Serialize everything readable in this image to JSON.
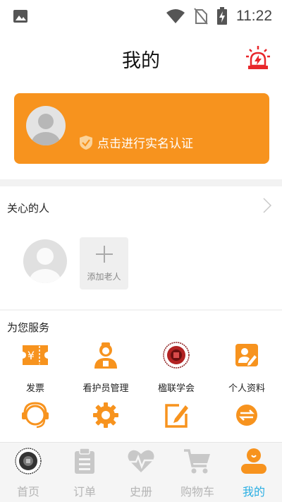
{
  "status_bar": {
    "time": "11:22",
    "icons": [
      "image-icon",
      "wifi-icon",
      "no-sim-icon",
      "battery-charging-icon"
    ]
  },
  "header": {
    "title": "我的",
    "alarm_icon": "alarm-siren-icon"
  },
  "profile": {
    "verify_text": "点击进行实名认证",
    "card_color": "#f7931e"
  },
  "care": {
    "title": "关心的人",
    "add_label": "添加老人"
  },
  "services": {
    "title": "为您服务",
    "items": [
      {
        "label": "发票",
        "icon": "invoice-ticket-icon"
      },
      {
        "label": "看护员管理",
        "icon": "caregiver-icon"
      },
      {
        "label": "楹联学会",
        "icon": "couplet-society-seal-icon"
      },
      {
        "label": "个人资料",
        "icon": "profile-edit-icon"
      },
      {
        "label": "",
        "icon": "headset-service-icon"
      },
      {
        "label": "",
        "icon": "settings-gear-icon"
      },
      {
        "label": "",
        "icon": "edit-note-icon"
      },
      {
        "label": "",
        "icon": "exchange-icon"
      }
    ]
  },
  "tabs": [
    {
      "label": "首页",
      "icon": "home-seal-icon"
    },
    {
      "label": "订单",
      "icon": "clipboard-icon"
    },
    {
      "label": "史册",
      "icon": "heart-pulse-icon"
    },
    {
      "label": "购物车",
      "icon": "cart-icon"
    },
    {
      "label": "我的",
      "icon": "person-icon",
      "active": true
    }
  ],
  "colors": {
    "accent_orange": "#f7931e",
    "active_tab_blue": "#29aee3",
    "inactive_tab_gray": "#b5b5b5"
  }
}
